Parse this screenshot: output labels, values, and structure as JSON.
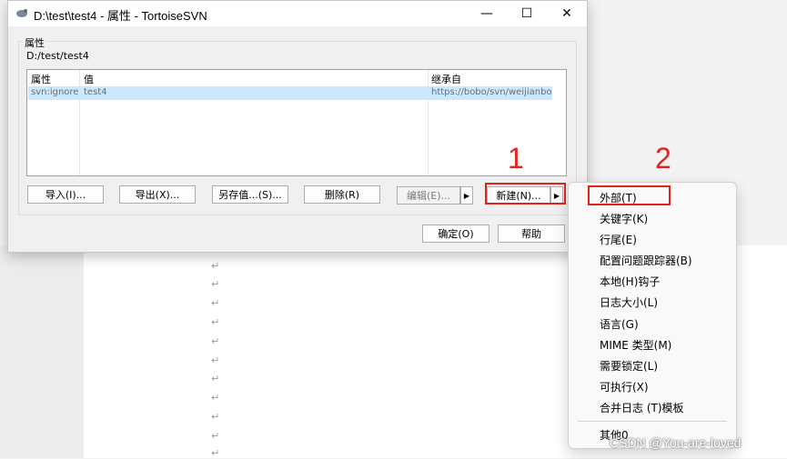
{
  "window": {
    "title": "D:\\test\\test4 - 属性 - TortoiseSVN",
    "minimize_glyph": "—",
    "maximize_glyph": "☐",
    "close_glyph": "✕"
  },
  "properties": {
    "group_label": "属性",
    "path": "D:/test/test4",
    "columns": [
      "属性",
      "值",
      "继承自"
    ],
    "rows": [
      {
        "property": "svn:ignore",
        "value": "test4",
        "inherited_from": "https://bobo/svn/weijianbo"
      }
    ]
  },
  "buttons": {
    "import": "导入(I)...",
    "export": "导出(X)...",
    "save_value_as": "另存值...(S)...",
    "delete": "删除(R)",
    "edit": "编辑(E)...",
    "new": "新建(N)...",
    "ok": "确定(O)",
    "help": "帮助"
  },
  "context_menu": {
    "items": [
      "外部(T)",
      "关键字(K)",
      "行尾(E)",
      "配置问题跟踪器(B)",
      "本地(H)钩子",
      "日志大小(L)",
      "语言(G)",
      "MIME 类型(M)",
      "需要锁定(L)",
      "可执行(X)",
      "合并日志 (T)模板"
    ],
    "other": "其他0"
  },
  "annotations": {
    "step1": "1",
    "step2": "2"
  },
  "background": {
    "paragraph_mark": "↵"
  },
  "watermark": "CSDN @You-are-loved",
  "colors": {
    "selection": "#cce8ff",
    "annotation_red": "#e2231a"
  }
}
